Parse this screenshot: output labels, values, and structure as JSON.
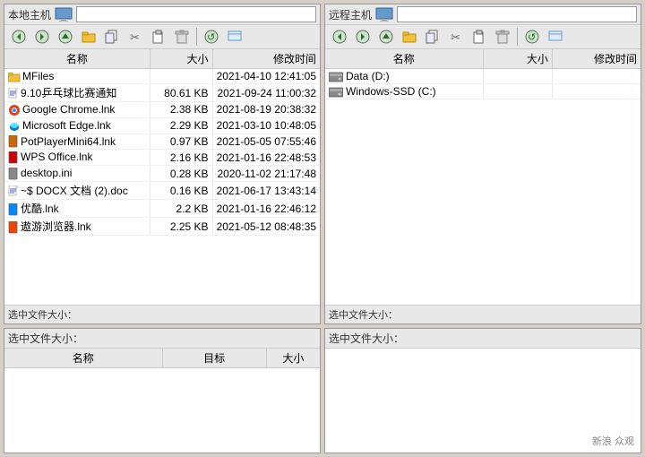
{
  "left_panel": {
    "label": "本地主机",
    "path": "",
    "toolbar_buttons": [
      "◀",
      "▶",
      "↑",
      "📁",
      "📋",
      "✂",
      "📄",
      "🗑",
      "🔄",
      "⚙"
    ],
    "columns": [
      "名称",
      "大小",
      "修改时间"
    ],
    "files": [
      {
        "name": "MFiles",
        "size": "",
        "date": "2021-04-10 12:41:05",
        "icon": "folder",
        "color": "#f0c040"
      },
      {
        "name": "9.10乒乓球比赛通知",
        "size": "80.61 KB",
        "date": "2021-09-24 11:00:32",
        "icon": "doc",
        "color": "#4466cc"
      },
      {
        "name": "Google Chrome.lnk",
        "size": "2.38 KB",
        "date": "2021-08-19 20:38:32",
        "icon": "chrome",
        "color": "#dd4422"
      },
      {
        "name": "Microsoft Edge.lnk",
        "size": "2.29 KB",
        "date": "2021-03-10 10:48:05",
        "icon": "edge",
        "color": "#0078d7"
      },
      {
        "name": "PotPlayerMini64.lnk",
        "size": "0.97 KB",
        "date": "2021-05-05 07:55:46",
        "icon": "video",
        "color": "#cc6600"
      },
      {
        "name": "WPS Office.lnk",
        "size": "2.16 KB",
        "date": "2021-01-16 22:48:53",
        "icon": "wps",
        "color": "#cc0000"
      },
      {
        "name": "desktop.ini",
        "size": "0.28 KB",
        "date": "2020-11-02 21:17:48",
        "icon": "ini",
        "color": "#888888"
      },
      {
        "name": "~$ DOCX 文档 (2).doc",
        "size": "0.16 KB",
        "date": "2021-06-17 13:43:14",
        "icon": "doc2",
        "color": "#4466cc"
      },
      {
        "name": "优酷.lnk",
        "size": "2.2 KB",
        "date": "2021-01-16 22:46:12",
        "icon": "youku",
        "color": "#0088ff"
      },
      {
        "name": "遨游浏览器.lnk",
        "size": "2.25 KB",
        "date": "2021-05-12 08:48:35",
        "icon": "browser",
        "color": "#ee4400"
      }
    ],
    "status": "选中文件大小："
  },
  "right_panel": {
    "label": "远程主机",
    "path": "",
    "toolbar_buttons": [
      "◀",
      "▶",
      "↑",
      "📁",
      "📋",
      "✂",
      "📄",
      "🗑",
      "🔄",
      "⚙"
    ],
    "columns": [
      "名称",
      "大小",
      "修改时间"
    ],
    "drives": [
      {
        "name": "Data (D:)",
        "icon": "hdd"
      },
      {
        "name": "Windows-SSD (C:)",
        "icon": "ssd"
      }
    ],
    "status": "选中文件大小："
  },
  "bottom_left": {
    "status": "选中文件大小：",
    "columns": [
      "名称",
      "目标",
      "大小"
    ]
  },
  "bottom_right": {
    "status": "选中文件大小：",
    "columns": []
  },
  "watermark": "新浪 众观"
}
